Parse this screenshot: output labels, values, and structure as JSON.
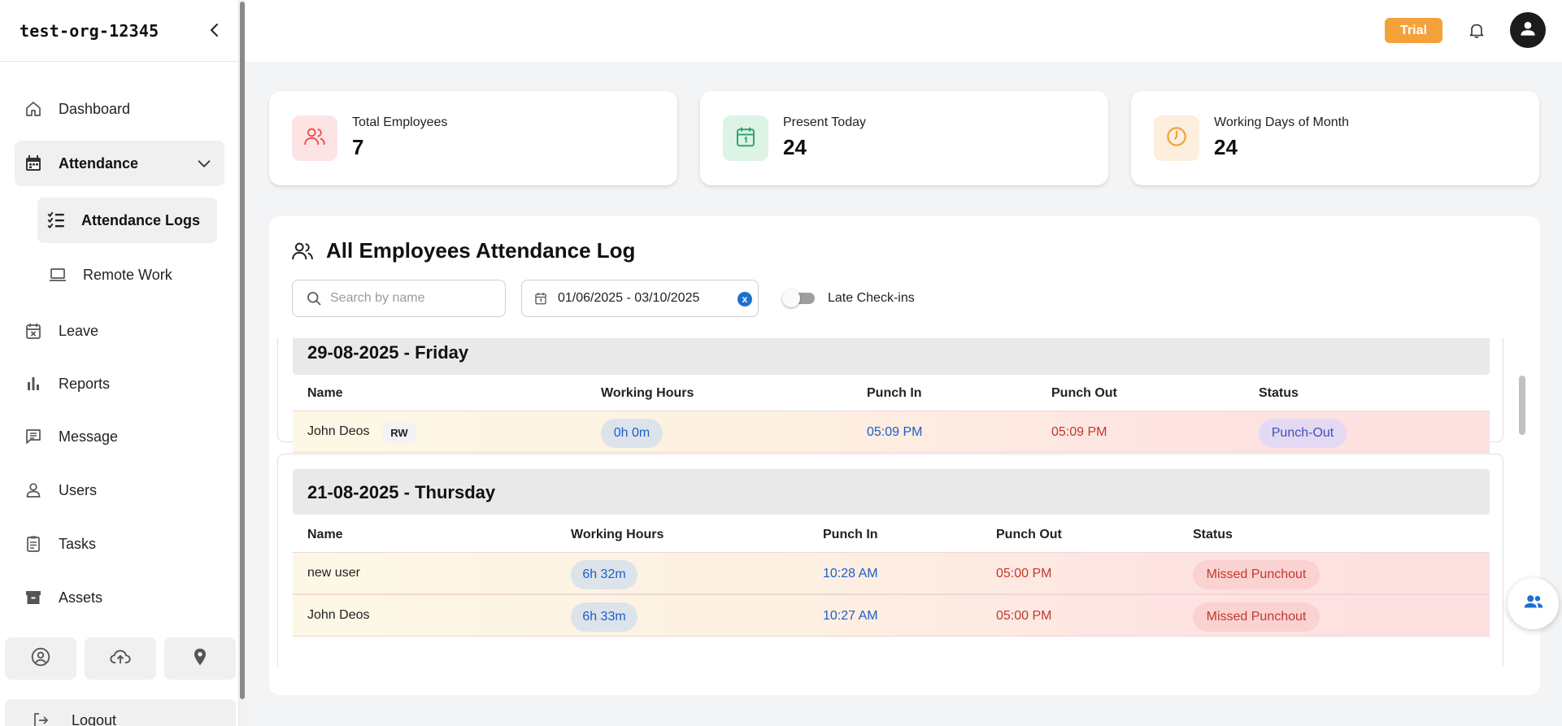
{
  "sidebar": {
    "org_name": "test-org-12345",
    "items": [
      {
        "label": "Dashboard",
        "icon": "home-icon"
      },
      {
        "label": "Attendance",
        "icon": "calendar-icon"
      },
      {
        "label": "Attendance Logs",
        "icon": "checklist-icon"
      },
      {
        "label": "Remote Work",
        "icon": "laptop-icon"
      },
      {
        "label": "Leave",
        "icon": "calendar-x-icon"
      },
      {
        "label": "Reports",
        "icon": "bar-chart-icon"
      },
      {
        "label": "Message",
        "icon": "message-icon"
      },
      {
        "label": "Users",
        "icon": "user-icon"
      },
      {
        "label": "Tasks",
        "icon": "clipboard-icon"
      },
      {
        "label": "Assets",
        "icon": "archive-icon"
      }
    ],
    "logout_label": "Logout"
  },
  "header": {
    "trial_label": "Trial"
  },
  "stats": [
    {
      "title": "Total Employees",
      "value": "7",
      "color": "#ef5350"
    },
    {
      "title": "Present Today",
      "value": "24",
      "color": "#2ea56a"
    },
    {
      "title": "Working Days of Month",
      "value": "24",
      "color": "#f5a13a"
    }
  ],
  "panel": {
    "title": "All Employees Attendance Log",
    "search_placeholder": "Search by name",
    "date_range": "01/06/2025 - 03/10/2025",
    "clear_label": "x",
    "toggle_label": "Late Check-ins"
  },
  "days": [
    {
      "date": "29-08-2025 - Friday",
      "columns": [
        "Name",
        "Working Hours",
        "Punch In",
        "Punch Out",
        "Status"
      ],
      "rows": [
        {
          "name": "John Deos",
          "badge": "RW",
          "hours": "0h 0m",
          "punch_in": "05:09 PM",
          "punch_out": "05:09 PM",
          "status": "Punch-Out"
        }
      ]
    },
    {
      "date": "21-08-2025 - Thursday",
      "columns": [
        "Name",
        "Working Hours",
        "Punch In",
        "Punch Out",
        "Status"
      ],
      "rows": [
        {
          "name": "new user",
          "hours": "6h 32m",
          "punch_in": "10:28 AM",
          "punch_out": "05:00 PM",
          "status": "Missed Punchout"
        },
        {
          "name": "John Deos",
          "hours": "6h 33m",
          "punch_in": "10:27 AM",
          "punch_out": "05:00 PM",
          "status": "Missed Punchout"
        }
      ]
    }
  ]
}
